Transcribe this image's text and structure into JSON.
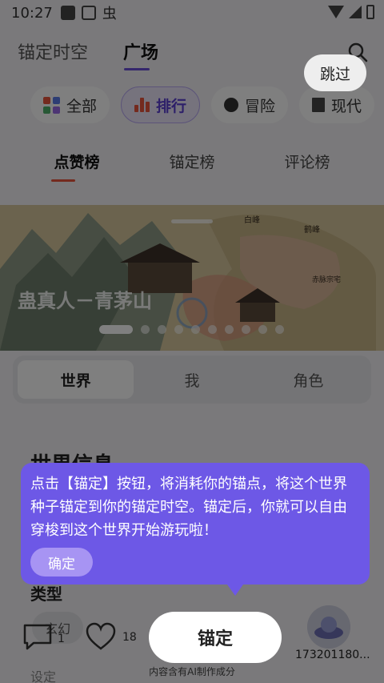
{
  "status_bar": {
    "time": "10:27",
    "app_glyph": "虫"
  },
  "top_tabs": [
    {
      "label": "锚定时空",
      "active": false
    },
    {
      "label": "广场",
      "active": true
    }
  ],
  "skip_label": "跳过",
  "categories": [
    {
      "label": "全部",
      "icon": "grid-icon"
    },
    {
      "label": "排行",
      "icon": "bar-chart-icon",
      "active": true
    },
    {
      "label": "冒险",
      "icon": "compass-icon"
    },
    {
      "label": "现代",
      "icon": "building-icon"
    }
  ],
  "sub_tabs": [
    {
      "label": "点赞榜",
      "active": true
    },
    {
      "label": "锚定榜"
    },
    {
      "label": "评论榜"
    }
  ],
  "banner": {
    "title": "蛊真人－青茅山",
    "map_labels": [
      "白峰",
      "鹤峰",
      "赤脉宗宅"
    ],
    "slide_count": 10,
    "active_slide": 1
  },
  "segment": [
    {
      "label": "世界",
      "active": true
    },
    {
      "label": "我"
    },
    {
      "label": "角色"
    }
  ],
  "section_title": "世界信息",
  "type_label": "类型",
  "type_chip": "玄幻",
  "comment_count": "1",
  "like_count": "18",
  "user_id": "173201180...",
  "ai_note": "内容含有AI制作成分",
  "footer_text": "设定",
  "tooltip": {
    "text": "点击【锚定】按钮，将消耗你的锚点，将这个世界种子锚定到你的锚定时空。锚定后，你就可以自由穿梭到这个世界开始游玩啦！",
    "confirm": "确定"
  },
  "anchor_button": "锚定",
  "colors": {
    "accent": "#6d58e6",
    "rank_red": "#e8553d",
    "overlay": "rgba(0,0,0,0.5)"
  }
}
